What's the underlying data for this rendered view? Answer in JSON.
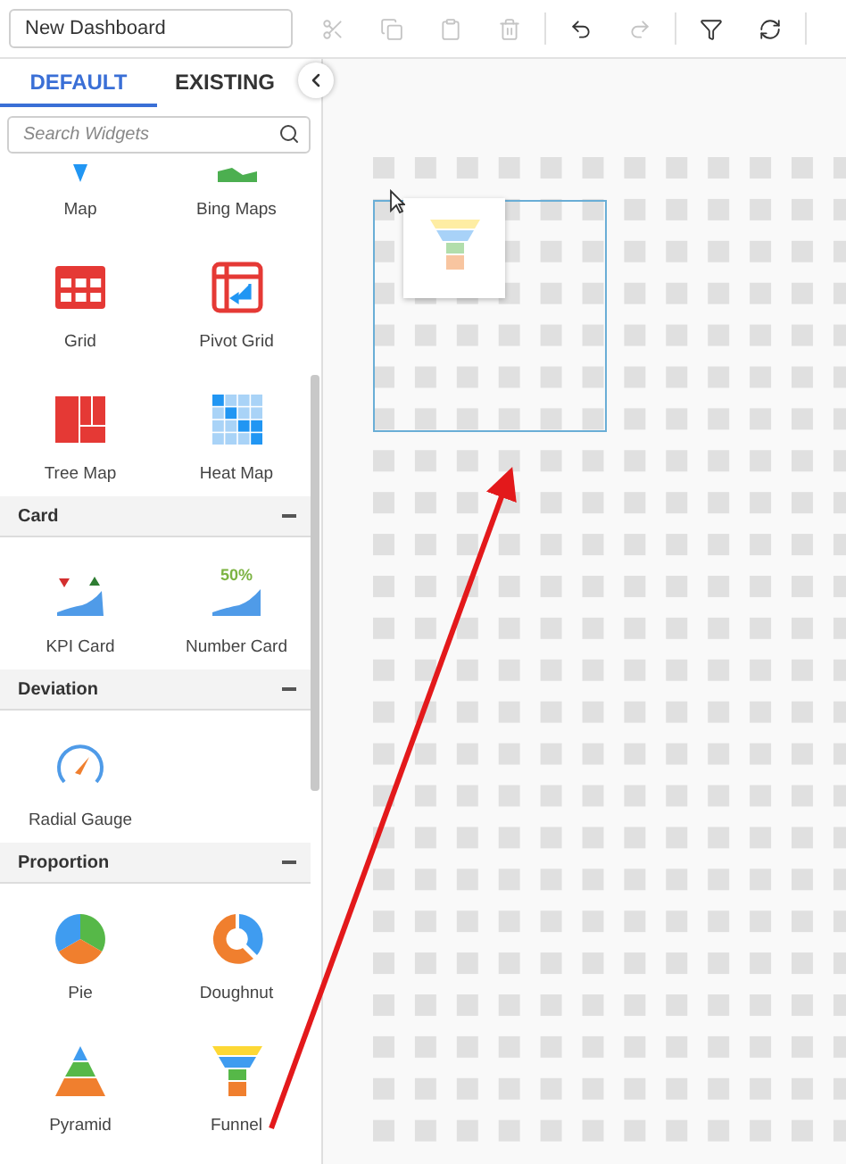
{
  "document_name": "New Dashboard",
  "toolbar": [
    {
      "kind": "cut",
      "disabled": true
    },
    {
      "kind": "copy",
      "disabled": true
    },
    {
      "kind": "paste",
      "disabled": true
    },
    {
      "kind": "delete",
      "disabled": true
    },
    {
      "kind": "separator"
    },
    {
      "kind": "undo",
      "disabled": false
    },
    {
      "kind": "redo",
      "disabled": true
    },
    {
      "kind": "separator"
    },
    {
      "kind": "filter",
      "disabled": false
    },
    {
      "kind": "refresh",
      "disabled": false
    },
    {
      "kind": "separator"
    }
  ],
  "tabs": [
    {
      "label": "DEFAULT",
      "selected": true
    },
    {
      "label": "EXISTING",
      "selected": false
    }
  ],
  "search": {
    "placeholder": "Search Widgets"
  },
  "sections": [
    {
      "widgets": [
        {
          "kind": "map",
          "label": "Map"
        },
        {
          "kind": "bing",
          "label": "Bing Maps"
        },
        {
          "kind": "grid",
          "label": "Grid"
        },
        {
          "kind": "pivot",
          "label": "Pivot Grid"
        },
        {
          "kind": "treemap",
          "label": "Tree Map"
        },
        {
          "kind": "heatmap",
          "label": "Heat Map"
        }
      ]
    },
    {
      "title": "Card",
      "expanded": true,
      "widgets": [
        {
          "kind": "kpi",
          "label": "KPI Card"
        },
        {
          "kind": "number",
          "label": "Number Card",
          "icon_text": "50%"
        }
      ]
    },
    {
      "title": "Deviation",
      "expanded": true,
      "widgets": [
        {
          "kind": "gauge",
          "label": "Radial Gauge"
        }
      ]
    },
    {
      "title": "Proportion",
      "expanded": true,
      "widgets": [
        {
          "kind": "pie",
          "label": "Pie"
        },
        {
          "kind": "doughnut",
          "label": "Doughnut"
        },
        {
          "kind": "pyramid",
          "label": "Pyramid"
        },
        {
          "kind": "funnel",
          "label": "Funnel"
        }
      ]
    }
  ],
  "drag_preview": {
    "kind": "funnel"
  }
}
